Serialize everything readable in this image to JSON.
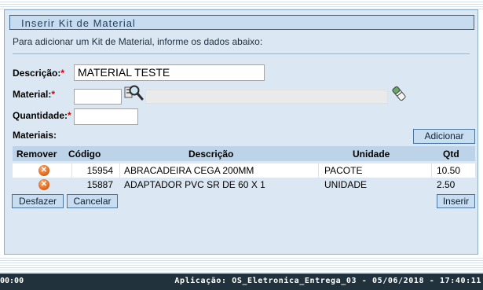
{
  "panel": {
    "title": "Inserir Kit de Material",
    "instruction": "Para adicionar um Kit de Material, informe os dados abaixo:"
  },
  "form": {
    "descricao": {
      "label": "Descrição:",
      "required_mark": "*",
      "value": "MATERIAL TESTE"
    },
    "material": {
      "label": "Material:",
      "required_mark": "*",
      "value": "",
      "description_value": ""
    },
    "quantidade": {
      "label": "Quantidade:",
      "required_mark": "*",
      "value": ""
    },
    "materiais_label": "Materiais:",
    "add_button": "Adicionar"
  },
  "table": {
    "headers": [
      "Remover",
      "Código",
      "Descrição",
      "Unidade",
      "Qtd"
    ],
    "rows": [
      {
        "codigo": "15954",
        "descricao": "ABRACADEIRA CEGA 200MM",
        "unidade": "PACOTE",
        "qtd": "10.50"
      },
      {
        "codigo": "15887",
        "descricao": "ADAPTADOR PVC SR DE 60 X 1",
        "unidade": "UNIDADE",
        "qtd": "2.50"
      }
    ],
    "remove_icon": "remove-x-icon"
  },
  "buttons": {
    "undo": "Desfazer",
    "cancel": "Cancelar",
    "insert": "Inserir"
  },
  "status": {
    "left": "00:00",
    "right": "Aplicação: OS_Eletronica_Entrega_03 - 05/06/2018 - 17:40:11"
  },
  "colors": {
    "panel_bg": "#dbe8f3",
    "header_bg": "#c7dcee",
    "table_header_bg": "#bcd3e8",
    "status_bar_bg": "#22323c",
    "required": "#d00000",
    "remove_icon": "#e2691d"
  }
}
